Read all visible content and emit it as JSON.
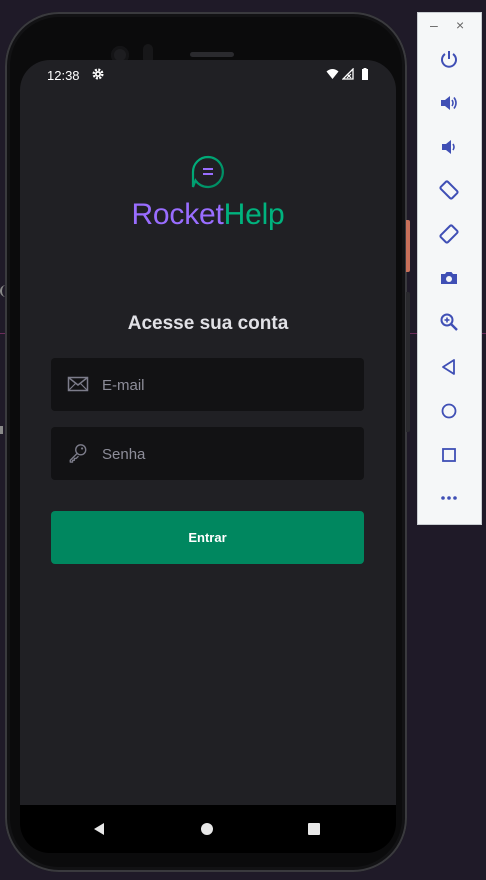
{
  "status_bar": {
    "time": "12:38"
  },
  "brand": {
    "part1": "Rocket",
    "part2": "Help"
  },
  "login": {
    "heading": "Acesse sua conta",
    "email_placeholder": "E-mail",
    "password_placeholder": "Senha",
    "submit_label": "Entrar"
  },
  "emulator": {
    "minimize": "–",
    "close": "×",
    "tools": [
      "power-icon",
      "volume-up-icon",
      "volume-down-icon",
      "rotate-left-icon",
      "rotate-right-icon",
      "camera-icon",
      "zoom-icon",
      "back-icon",
      "home-icon",
      "overview-icon",
      "more-icon"
    ]
  },
  "colors": {
    "brand_purple": "#996DFF",
    "brand_green": "#00B37E",
    "button": "#00875F",
    "screen_bg": "#202024",
    "input_bg": "#121214"
  }
}
